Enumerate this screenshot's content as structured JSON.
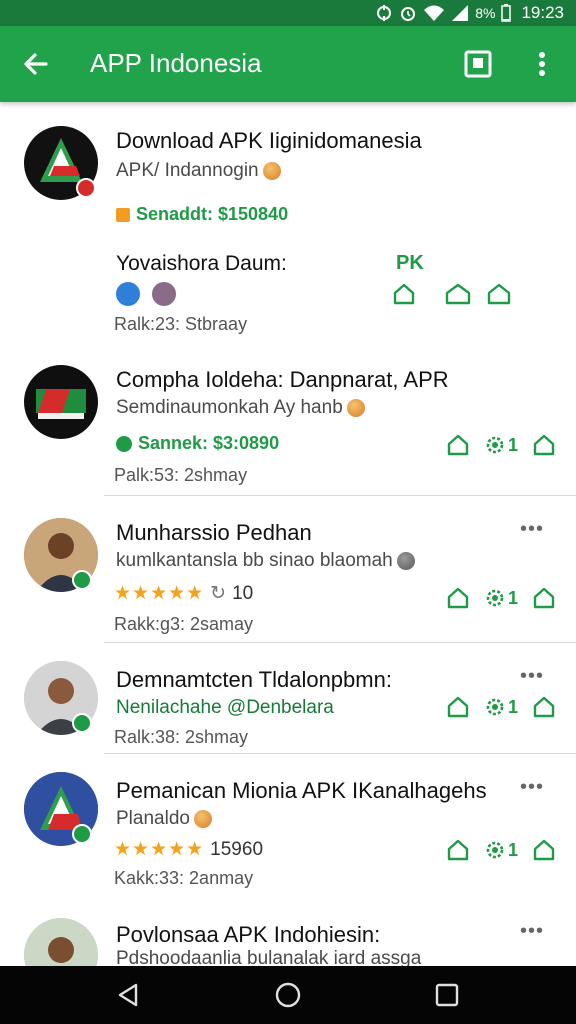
{
  "status_bar": {
    "battery": "8%",
    "time": "19:23"
  },
  "app_bar": {
    "title": "APP Indonesia"
  },
  "items": [
    {
      "title": "Download APK Iiginidomanesia",
      "subtitle": "APK/ Indannogin",
      "price": "Senaddt: $150840",
      "row_label": "Yovaishora Daum:",
      "row_tag": "PK",
      "meta": "Ralk:23:  Stbraay"
    },
    {
      "title": "Compha Ioldeha: Danpnarat, APR",
      "subtitle": "Semdinaumonkah Ay hanb",
      "price": "Sannek: $3:0890",
      "action_count": "1",
      "meta": "Palk:53:  2shmay"
    },
    {
      "title": "Munharssio Pedhan",
      "subtitle": "kumlkantansla bb sinao blaomah",
      "rating_stars": "★★★★★",
      "rating_value": "10",
      "action_count": "1",
      "meta": "Rakk:g3:  2samay"
    },
    {
      "title": "Demnamtcten Tldalonpbmn:",
      "subtitle": "Nenilachahe @Denbelara",
      "action_count": "1",
      "meta": "Ralk:38:  2shmay"
    },
    {
      "title": "Pemanican Mionia APK IKanalhagehs",
      "subtitle": "Planaldo",
      "rating_stars": "★★★★★",
      "rating_value": "15960",
      "action_count": "1",
      "meta": "Kakk:33:  2anmay"
    },
    {
      "title": "Povlonsaa APK Indohiesin:",
      "subtitle": "Pdshoodaanlia bulanalak iard assga"
    }
  ],
  "icons": {
    "back": "arrow-left-icon",
    "bookmark": "bookmark-icon",
    "overflow": "more-vert-icon",
    "action1": "home-outline-icon",
    "action2": "gear-icon",
    "action3": "home-outline-icon",
    "nav_back": "triangle-back-icon",
    "nav_home": "circle-home-icon",
    "nav_recent": "square-recents-icon"
  },
  "colors": {
    "primary": "#21a34c",
    "status_bar": "#1a7a3c",
    "accent_green": "#1f9a46",
    "star": "#f2a31b"
  }
}
